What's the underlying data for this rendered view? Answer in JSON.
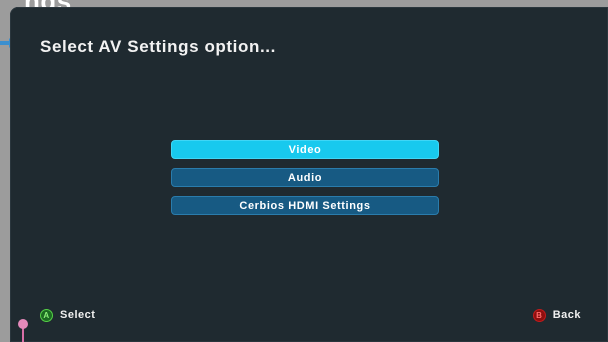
{
  "background": {
    "partial_title": "ngs"
  },
  "screen": {
    "title": "Select AV Settings option..."
  },
  "menu": {
    "items": [
      {
        "label": "Video",
        "selected": true
      },
      {
        "label": "Audio",
        "selected": false
      },
      {
        "label": "Cerbios HDMI Settings",
        "selected": false
      }
    ]
  },
  "footer": {
    "select": {
      "button": "A",
      "label": "Select"
    },
    "back": {
      "button": "B",
      "label": "Back"
    }
  },
  "colors": {
    "screen_bg": "#1f2a30",
    "item_bg": "#175a83",
    "item_selected_bg": "#18c9ee",
    "button_a": "#55d046",
    "button_b": "#c31b1b"
  },
  "icons": {
    "left_edge": "arrow-right-icon",
    "bottom_left": "pin-marker-icon"
  }
}
